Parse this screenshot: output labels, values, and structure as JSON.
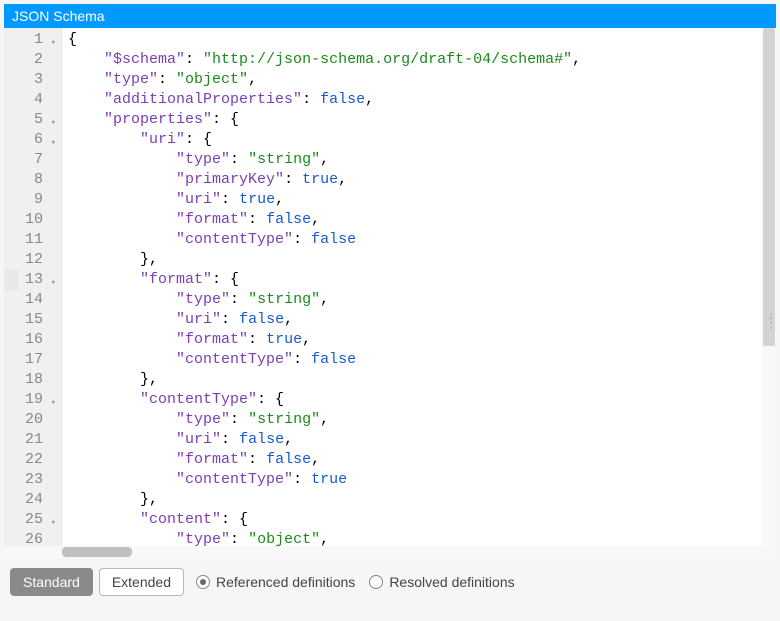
{
  "panel": {
    "title": "JSON Schema"
  },
  "code": {
    "lines": [
      {
        "n": 1,
        "fold": true,
        "indent": 0,
        "tokens": [
          [
            "p",
            "{"
          ]
        ]
      },
      {
        "n": 2,
        "fold": false,
        "indent": 1,
        "tokens": [
          [
            "key",
            "\"$schema\""
          ],
          [
            "p",
            ": "
          ],
          [
            "str",
            "\"http://json-schema.org/draft-04/schema#\""
          ],
          [
            "p",
            ","
          ]
        ]
      },
      {
        "n": 3,
        "fold": false,
        "indent": 1,
        "tokens": [
          [
            "key",
            "\"type\""
          ],
          [
            "p",
            ": "
          ],
          [
            "str",
            "\"object\""
          ],
          [
            "p",
            ","
          ]
        ]
      },
      {
        "n": 4,
        "fold": false,
        "indent": 1,
        "tokens": [
          [
            "key",
            "\"additionalProperties\""
          ],
          [
            "p",
            ": "
          ],
          [
            "bool",
            "false"
          ],
          [
            "p",
            ","
          ]
        ]
      },
      {
        "n": 5,
        "fold": true,
        "indent": 1,
        "tokens": [
          [
            "key",
            "\"properties\""
          ],
          [
            "p",
            ": {"
          ]
        ]
      },
      {
        "n": 6,
        "fold": true,
        "indent": 2,
        "tokens": [
          [
            "key",
            "\"uri\""
          ],
          [
            "p",
            ": {"
          ]
        ]
      },
      {
        "n": 7,
        "fold": false,
        "indent": 3,
        "tokens": [
          [
            "key",
            "\"type\""
          ],
          [
            "p",
            ": "
          ],
          [
            "str",
            "\"string\""
          ],
          [
            "p",
            ","
          ]
        ]
      },
      {
        "n": 8,
        "fold": false,
        "indent": 3,
        "tokens": [
          [
            "key",
            "\"primaryKey\""
          ],
          [
            "p",
            ": "
          ],
          [
            "bool",
            "true"
          ],
          [
            "p",
            ","
          ]
        ]
      },
      {
        "n": 9,
        "fold": false,
        "indent": 3,
        "tokens": [
          [
            "key",
            "\"uri\""
          ],
          [
            "p",
            ": "
          ],
          [
            "bool",
            "true"
          ],
          [
            "p",
            ","
          ]
        ]
      },
      {
        "n": 10,
        "fold": false,
        "indent": 3,
        "tokens": [
          [
            "key",
            "\"format\""
          ],
          [
            "p",
            ": "
          ],
          [
            "bool",
            "false"
          ],
          [
            "p",
            ","
          ]
        ]
      },
      {
        "n": 11,
        "fold": false,
        "indent": 3,
        "tokens": [
          [
            "key",
            "\"contentType\""
          ],
          [
            "p",
            ": "
          ],
          [
            "bool",
            "false"
          ]
        ]
      },
      {
        "n": 12,
        "fold": false,
        "indent": 2,
        "tokens": [
          [
            "p",
            "},"
          ]
        ]
      },
      {
        "n": 13,
        "fold": true,
        "indent": 2,
        "tokens": [
          [
            "key",
            "\"format\""
          ],
          [
            "p",
            ": {"
          ]
        ]
      },
      {
        "n": 14,
        "fold": false,
        "indent": 3,
        "tokens": [
          [
            "key",
            "\"type\""
          ],
          [
            "p",
            ": "
          ],
          [
            "str",
            "\"string\""
          ],
          [
            "p",
            ","
          ]
        ]
      },
      {
        "n": 15,
        "fold": false,
        "indent": 3,
        "tokens": [
          [
            "key",
            "\"uri\""
          ],
          [
            "p",
            ": "
          ],
          [
            "bool",
            "false"
          ],
          [
            "p",
            ","
          ]
        ]
      },
      {
        "n": 16,
        "fold": false,
        "indent": 3,
        "tokens": [
          [
            "key",
            "\"format\""
          ],
          [
            "p",
            ": "
          ],
          [
            "bool",
            "true"
          ],
          [
            "p",
            ","
          ]
        ]
      },
      {
        "n": 17,
        "fold": false,
        "indent": 3,
        "tokens": [
          [
            "key",
            "\"contentType\""
          ],
          [
            "p",
            ": "
          ],
          [
            "bool",
            "false"
          ]
        ]
      },
      {
        "n": 18,
        "fold": false,
        "indent": 2,
        "tokens": [
          [
            "p",
            "},"
          ]
        ]
      },
      {
        "n": 19,
        "fold": true,
        "indent": 2,
        "tokens": [
          [
            "key",
            "\"contentType\""
          ],
          [
            "p",
            ": {"
          ]
        ]
      },
      {
        "n": 20,
        "fold": false,
        "indent": 3,
        "tokens": [
          [
            "key",
            "\"type\""
          ],
          [
            "p",
            ": "
          ],
          [
            "str",
            "\"string\""
          ],
          [
            "p",
            ","
          ]
        ]
      },
      {
        "n": 21,
        "fold": false,
        "indent": 3,
        "tokens": [
          [
            "key",
            "\"uri\""
          ],
          [
            "p",
            ": "
          ],
          [
            "bool",
            "false"
          ],
          [
            "p",
            ","
          ]
        ]
      },
      {
        "n": 22,
        "fold": false,
        "indent": 3,
        "tokens": [
          [
            "key",
            "\"format\""
          ],
          [
            "p",
            ": "
          ],
          [
            "bool",
            "false"
          ],
          [
            "p",
            ","
          ]
        ]
      },
      {
        "n": 23,
        "fold": false,
        "indent": 3,
        "tokens": [
          [
            "key",
            "\"contentType\""
          ],
          [
            "p",
            ": "
          ],
          [
            "bool",
            "true"
          ]
        ]
      },
      {
        "n": 24,
        "fold": false,
        "indent": 2,
        "tokens": [
          [
            "p",
            "},"
          ]
        ]
      },
      {
        "n": 25,
        "fold": true,
        "indent": 2,
        "tokens": [
          [
            "key",
            "\"content\""
          ],
          [
            "p",
            ": {"
          ]
        ]
      },
      {
        "n": 26,
        "fold": false,
        "indent": 3,
        "tokens": [
          [
            "key",
            "\"type\""
          ],
          [
            "p",
            ": "
          ],
          [
            "str",
            "\"object\""
          ],
          [
            "p",
            ","
          ]
        ]
      }
    ]
  },
  "toolbar": {
    "standard": "Standard",
    "extended": "Extended",
    "referenced": "Referenced definitions",
    "resolved": "Resolved definitions"
  }
}
